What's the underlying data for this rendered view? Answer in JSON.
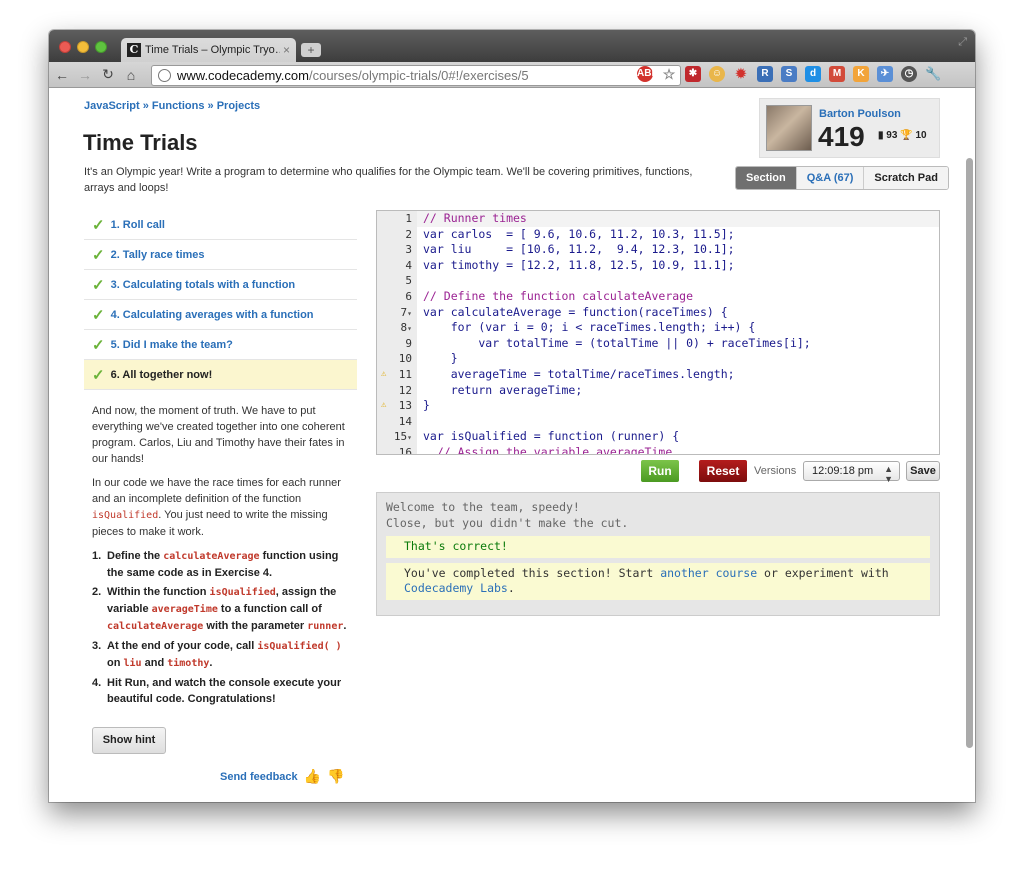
{
  "browser": {
    "tab_title": "Time Trials – Olympic Tryo…",
    "tab_close": "×",
    "new_tab": "+",
    "url_host": "www.codecademy.com",
    "url_path": "/courses/olympic-trials/0#!/exercises/5"
  },
  "breadcrumb": {
    "a": "JavaScript",
    "b": "Functions",
    "c": "Projects",
    "sep": "»"
  },
  "page_title": "Time Trials",
  "intro": "It's an Olympic year! Write a program to determine who qualifies for the Olympic team. We'll be covering primitives, functions, arrays and loops!",
  "profile": {
    "name": "Barton Poulson",
    "points": "419",
    "badge_count": "93",
    "trophy_count": "10"
  },
  "right_tabs": {
    "section": "Section",
    "qa": "Q&A (67)",
    "scratch": "Scratch Pad"
  },
  "exercises": [
    {
      "label": "1. Roll call"
    },
    {
      "label": "2. Tally race times"
    },
    {
      "label": "3. Calculating totals with a function"
    },
    {
      "label": "4. Calculating averages with a function"
    },
    {
      "label": "5. Did I make the team?"
    },
    {
      "label": "6. All together now!"
    }
  ],
  "description": {
    "p1": "And now, the moment of truth. We have to put everything we've created together into one coherent program. Carlos, Liu and Timothy have their fates in our hands!",
    "p2_a": "In our code we have the race times for each runner and an incomplete definition of the function ",
    "p2_code": "isQualified",
    "p2_b": ". You just need to write the missing pieces to make it work.",
    "s1_a": "Define the ",
    "s1_code": "calculateAverage",
    "s1_b": " function using the same code as in Exercise 4.",
    "s2_a": "Within the function ",
    "s2_code1": "isQualified",
    "s2_b": ", assign the variable ",
    "s2_code2": "averageTime",
    "s2_c": " to a function call of ",
    "s2_code3": "calculateAverage",
    "s2_d": " with the parameter ",
    "s2_code4": "runner",
    "s2_e": ".",
    "s3_a": "At the end of your code, call ",
    "s3_code1": "isQualified( )",
    "s3_b": " on ",
    "s3_code2": "liu",
    "s3_c": " and ",
    "s3_code3": "timothy",
    "s3_d": ".",
    "s4": "Hit Run, and watch the console execute your beautiful code. Congratulations!"
  },
  "show_hint": "Show hint",
  "send_feedback": "Send feedback",
  "code_lines": [
    {
      "n": "1",
      "t": "// Runner times",
      "cls": "c-com"
    },
    {
      "n": "2",
      "t": "var carlos  = [ 9.6, 10.6, 11.2, 10.3, 11.5];"
    },
    {
      "n": "3",
      "t": "var liu     = [10.6, 11.2,  9.4, 12.3, 10.1];"
    },
    {
      "n": "4",
      "t": "var timothy = [12.2, 11.8, 12.5, 10.9, 11.1];"
    },
    {
      "n": "5",
      "t": ""
    },
    {
      "n": "6",
      "t": "// Define the function calculateAverage",
      "cls": "c-com"
    },
    {
      "n": "7",
      "t": "var calculateAverage = function(raceTimes) {",
      "fold": true
    },
    {
      "n": "8",
      "t": "    for (var i = 0; i < raceTimes.length; i++) {",
      "fold": true
    },
    {
      "n": "9",
      "t": "        var totalTime = (totalTime || 0) + raceTimes[i];"
    },
    {
      "n": "10",
      "t": "    }"
    },
    {
      "n": "11",
      "t": "    averageTime = totalTime/raceTimes.length;",
      "warn": true
    },
    {
      "n": "12",
      "t": "    return averageTime;"
    },
    {
      "n": "13",
      "t": "}",
      "warn": true
    },
    {
      "n": "14",
      "t": ""
    },
    {
      "n": "15",
      "t": "var isQualified = function (runner) {",
      "fold": true
    },
    {
      "n": "16",
      "t": "  // Assign the variable averageTime",
      "cls": "c-com"
    }
  ],
  "editor_actions": {
    "run": "Run",
    "reset": "Reset",
    "versions_label": "Versions",
    "version_value": "12:09:18 pm",
    "save": "Save"
  },
  "console": {
    "line1": "Welcome to the team, speedy!",
    "line2": "Close, but you didn't make the cut.",
    "correct": "That's correct!",
    "complete_a": "You've completed this section! Start ",
    "complete_link1": "another course",
    "complete_b": " or experiment with ",
    "complete_link2": "Codecademy Labs",
    "complete_c": "."
  }
}
